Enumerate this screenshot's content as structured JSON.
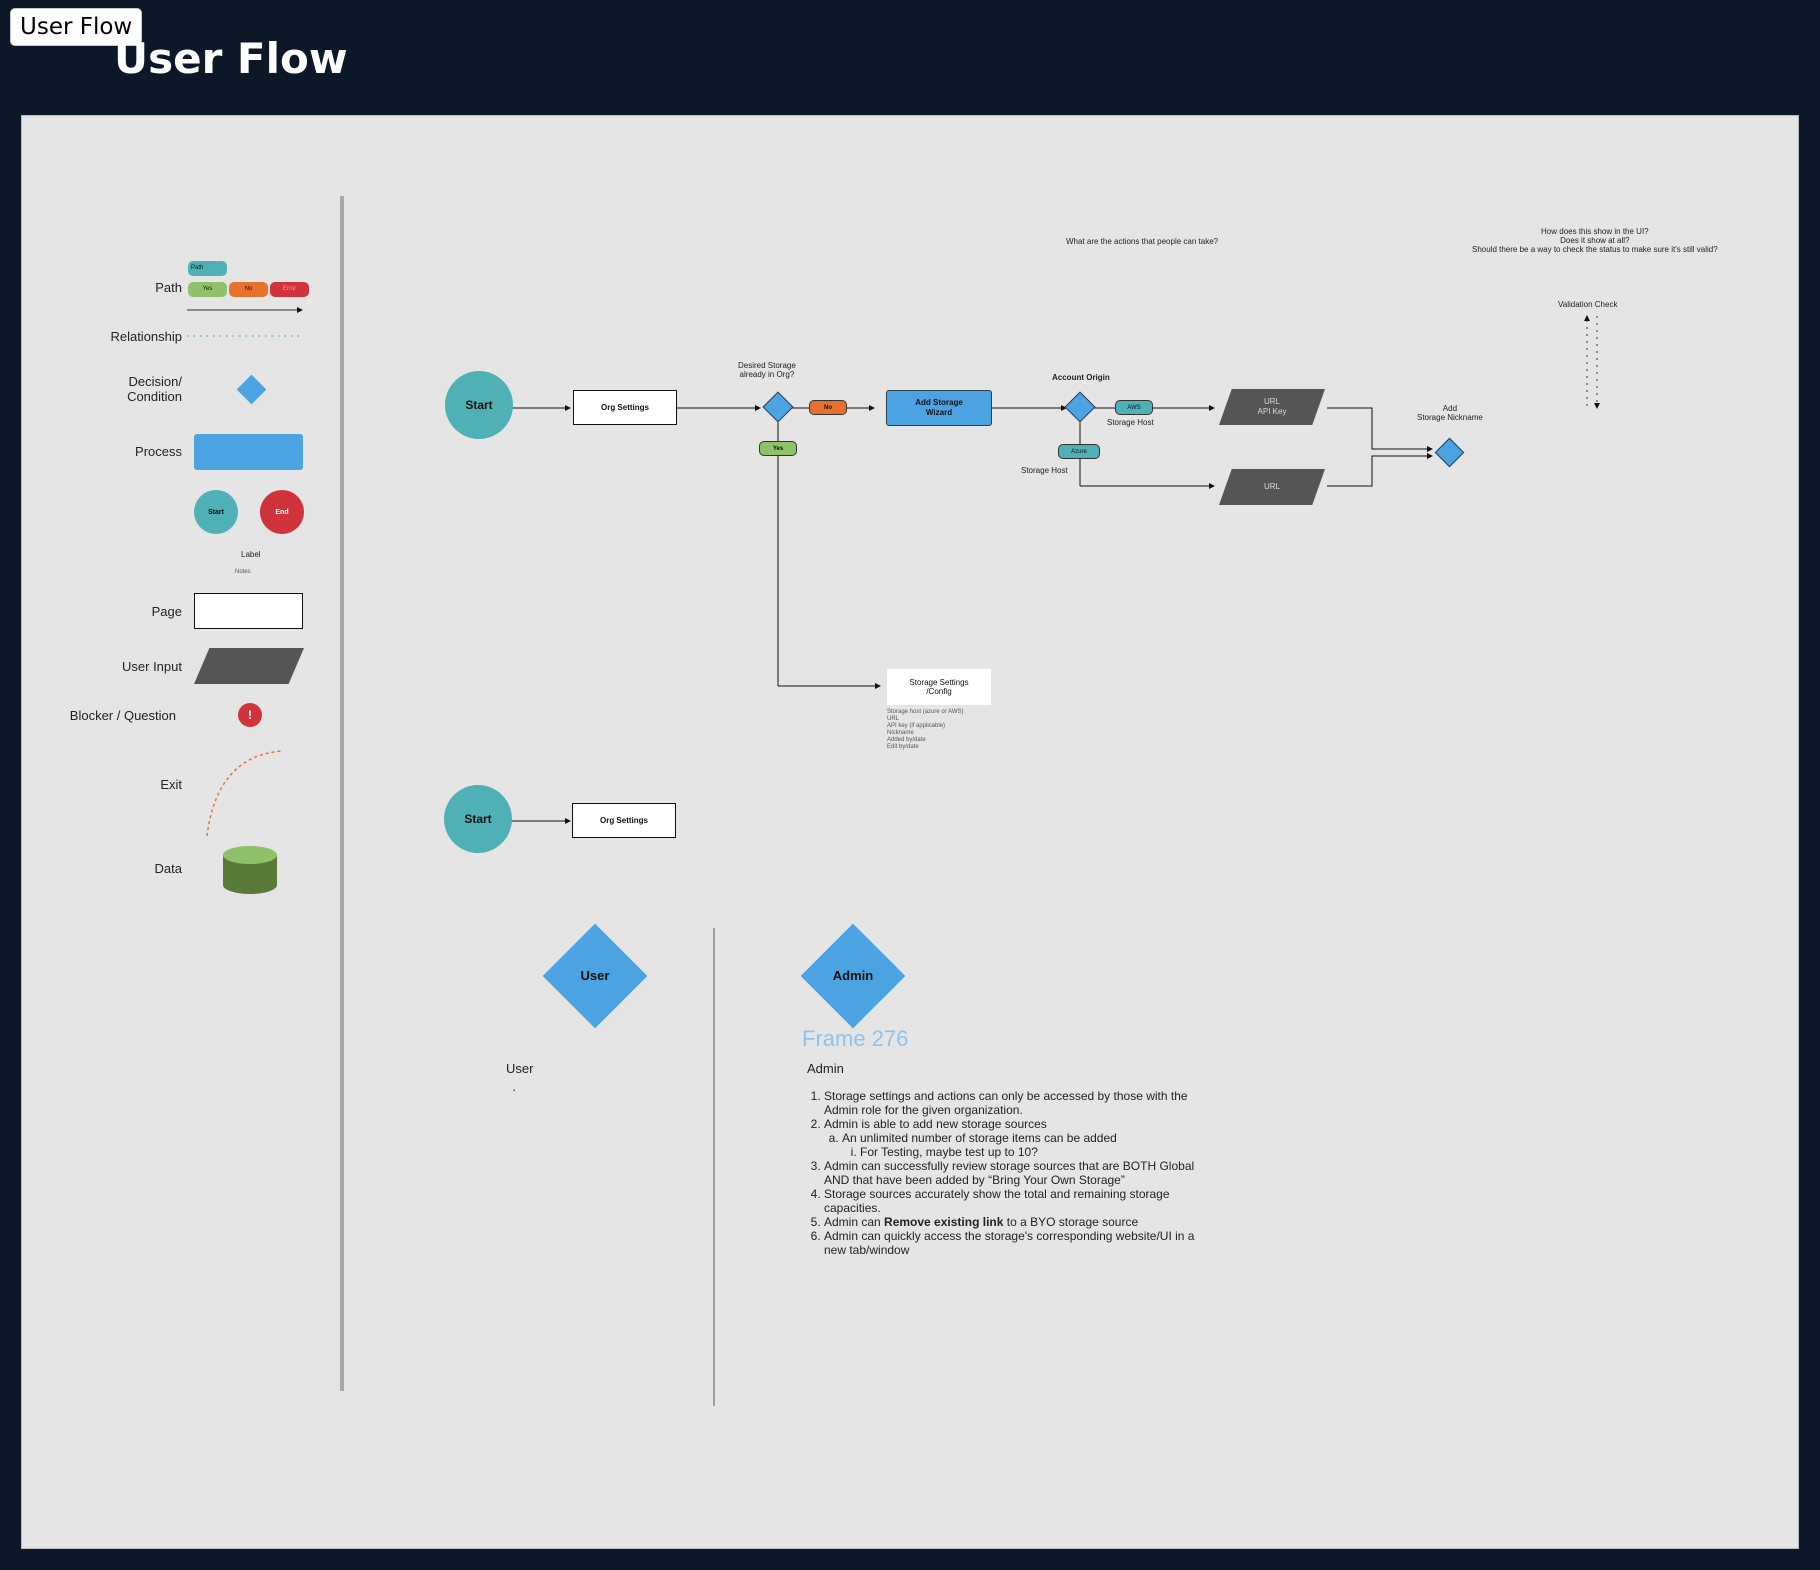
{
  "window": {
    "tab_label": "User Flow",
    "title": "User Flow"
  },
  "legend": {
    "path_label": "Path",
    "path_chip": "Path",
    "yes_chip": "Yes",
    "no_chip": "No",
    "error_chip": "Error",
    "relationship_label": "Relationship",
    "decision_label": "Decision/\nCondition",
    "process_label": "Process",
    "start_label": "Start",
    "end_label": "End",
    "label_text": "Label",
    "notes_text": "Notes",
    "page_label": "Page",
    "user_input_label": "User Input",
    "blocker_label": "Blocker / Question",
    "blocker_glyph": "!",
    "exit_label": "Exit",
    "data_label": "Data"
  },
  "flow": {
    "start_1": "Start",
    "org_settings_1": "Org Settings",
    "desired_storage": "Desired Storage\nalready in Org?",
    "no_chip": "No",
    "yes_chip": "Yes",
    "add_storage_wizard": "Add Storage\nWizard",
    "account_origin": "Account Origin",
    "aws_chip": "AWS",
    "storage_host_1": "Storage Host",
    "azure_chip": "Azure",
    "storage_host_2": "Storage Host",
    "url_api_key": "URL\nAPI Key",
    "url": "URL",
    "add_nickname": "Add\nStorage Nickname",
    "actions_question": "What are the actions that people can take?",
    "ui_questions": "How does this show in the UI?\nDoes it show at all?\nShould there be a way to check the status to make sure it's still valid?",
    "validation_check": "Validation Check",
    "storage_settings": "Storage Settings\n/Config",
    "storage_settings_notes": "Storage host (azure or AWS)\nURL\nAPI key (if applicable)\nNickname\nAdded by/date\nEdit by/date",
    "start_2": "Start",
    "org_settings_2": "Org Settings"
  },
  "roles": {
    "user_diamond": "User",
    "admin_diamond": "Admin",
    "frame_label": "Frame 276",
    "user_heading": "User",
    "user_bullet": "·",
    "admin_heading": "Admin",
    "admin_items": {
      "i1": "Storage settings and actions can only be accessed by those with the Admin role for the given organization.",
      "i2": "Admin is able to add new storage sources",
      "i2a": "An unlimited number of storage items can be added",
      "i2a_i": "For Testing, maybe test up to 10?",
      "i3": "Admin can successfully review storage sources that are BOTH Global AND that have been added by “Bring Your Own Storage”",
      "i4": "Storage sources accurately show the total and remaining storage capacities.",
      "i5_pre": "Admin can ",
      "i5_bold": "Remove existing link",
      "i5_post": " to a BYO storage source",
      "i6": "Admin can quickly access the storage's corresponding website/UI in a new tab/window"
    }
  },
  "colors": {
    "background": "#0c1828",
    "board": "#e5e5e5",
    "teal": "#4fb0b6",
    "blue": "#4ba3e2",
    "green": "#8dc26b",
    "orange": "#e8712f",
    "red": "#d0333c",
    "dark_input": "#555555",
    "data_top": "#8dc26b",
    "data_body": "#5a7a3a"
  },
  "icons": {
    "blocker": "exclamation-icon",
    "decision": "diamond-icon",
    "data": "cylinder-icon"
  }
}
